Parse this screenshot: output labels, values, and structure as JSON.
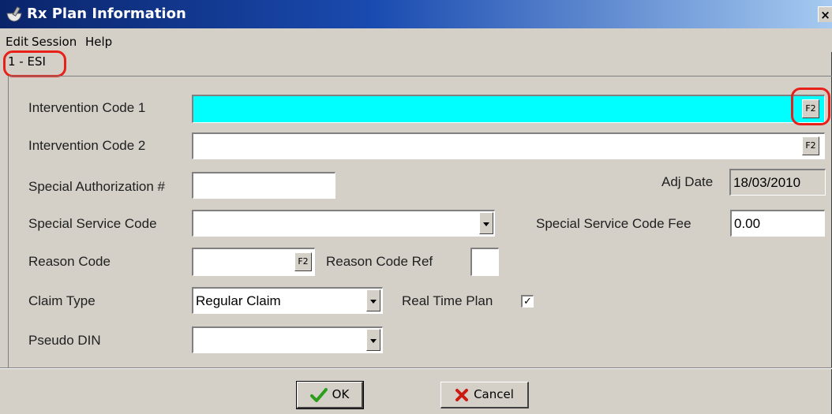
{
  "window": {
    "title": "Rx Plan Information",
    "close_glyph": "×",
    "icon": "mortar-pestle-icon"
  },
  "menu": {
    "items": [
      "Edit",
      "Session",
      "Help"
    ]
  },
  "plan_label": "1 - ESI",
  "form": {
    "intervention_code_1": {
      "label": "Intervention Code 1",
      "value": "",
      "lookup": "F2"
    },
    "intervention_code_2": {
      "label": "Intervention Code 2",
      "value": "",
      "lookup": "F2"
    },
    "special_authorization": {
      "label": "Special Authorization #",
      "value": ""
    },
    "adj_date": {
      "label": "Adj Date",
      "value": "18/03/2010"
    },
    "special_service_code": {
      "label": "Special Service Code",
      "value": ""
    },
    "special_service_code_fee": {
      "label": "Special Service Code Fee",
      "value": "0.00"
    },
    "reason_code": {
      "label": "Reason Code",
      "value": "",
      "lookup": "F2"
    },
    "reason_code_ref": {
      "label": "Reason Code Ref",
      "value": ""
    },
    "claim_type": {
      "label": "Claim Type",
      "value": "Regular Claim"
    },
    "real_time_plan": {
      "label": "Real Time Plan",
      "checked": true,
      "mark": "✓"
    },
    "pseudo_din": {
      "label": "Pseudo DIN",
      "value": ""
    }
  },
  "buttons": {
    "ok": "OK",
    "cancel": "Cancel"
  },
  "colors": {
    "highlight": "#e8201a",
    "active_field": "#00ffff",
    "ok_check": "#2a9d1a",
    "cancel_x": "#cc1a10"
  }
}
